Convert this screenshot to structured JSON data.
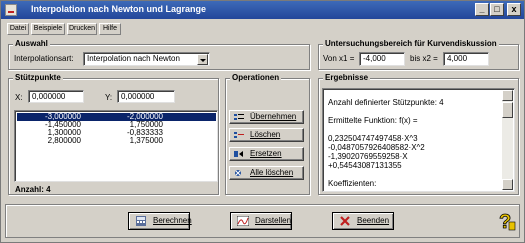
{
  "window": {
    "title": "Interpolation nach Newton und Lagrange"
  },
  "titlebar_buttons": [
    "_",
    "□",
    "x"
  ],
  "menu": [
    "Datei",
    "Beispiele",
    "Drucken",
    "Hilfe"
  ],
  "auswahl": {
    "title": "Auswahl",
    "label": "Interpolationsart:",
    "selected": "Interpolation nach Newton"
  },
  "untersuchung": {
    "title": "Untersuchungsbereich für Kurvendiskussion",
    "x1_label": "Von x1 =",
    "x1_value": "-4,000",
    "x2_label": "bis x2 =",
    "x2_value": "4,000"
  },
  "stuetzpunkte": {
    "title": "Stützpunkte",
    "x_label": "X:",
    "x_value": "0,000000",
    "y_label": "Y:",
    "y_value": "0,000000",
    "rows": [
      {
        "x": "-3,000000",
        "y": "-2,000000"
      },
      {
        "x": "-1,450000",
        "y": "1,750000"
      },
      {
        "x": "1,300000",
        "y": "-0,833333"
      },
      {
        "x": "2,800000",
        "y": "1,375000"
      }
    ],
    "count_label": "Anzahl: 4"
  },
  "operationen": {
    "title": "Operationen",
    "buttons": [
      "Übernehmen",
      "Löschen",
      "Ersetzen",
      "Alle löschen"
    ]
  },
  "ergebnisse": {
    "title": "Ergebnisse",
    "lines": [
      "Anzahl definierter Stützpunkte: 4",
      "Ermittelte Funktion:  f(x) =",
      "0,232504747497458·X^3",
      "-0,0487057926408582·X^2",
      "-1,39020769559258·X",
      "+0,54543087131355",
      "Koeffizienten:"
    ]
  },
  "bottom": {
    "buttons": [
      "Berechnen",
      "Darstellen",
      "Beenden"
    ]
  },
  "colors": {
    "titlebar": "#23469a",
    "selection": "#0a246a",
    "face": "#d4d0c8"
  }
}
